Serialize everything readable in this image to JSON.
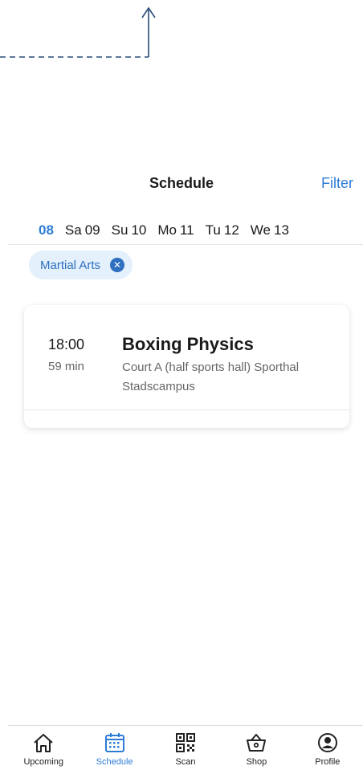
{
  "header": {
    "title": "Schedule",
    "filter_label": "Filter"
  },
  "dates": [
    {
      "dow": "",
      "day": "08",
      "active": true
    },
    {
      "dow": "Sa",
      "day": "09",
      "active": false
    },
    {
      "dow": "Su",
      "day": "10",
      "active": false
    },
    {
      "dow": "Mo",
      "day": "11",
      "active": false
    },
    {
      "dow": "Tu",
      "day": "12",
      "active": false
    },
    {
      "dow": "We",
      "day": "13",
      "active": false
    }
  ],
  "filter_chip": {
    "label": "Martial Arts",
    "remove_icon": "close-circle-icon"
  },
  "classes": [
    {
      "time": "18:00",
      "duration": "59 min",
      "name": "Boxing Physics",
      "location": "Court A (half sports hall) Sporthal Stadscampus"
    }
  ],
  "tabbar": [
    {
      "label": "Upcoming",
      "icon": "home-icon",
      "active": false
    },
    {
      "label": "Schedule",
      "icon": "calendar-icon",
      "active": true
    },
    {
      "label": "Scan",
      "icon": "qr-code-icon",
      "active": false
    },
    {
      "label": "Shop",
      "icon": "basket-icon",
      "active": false
    },
    {
      "label": "Profile",
      "icon": "profile-icon",
      "active": false
    }
  ],
  "colors": {
    "accent": "#2e7cd6",
    "chip_bg": "#e4f0fb",
    "guide": "#2a4d7a"
  }
}
